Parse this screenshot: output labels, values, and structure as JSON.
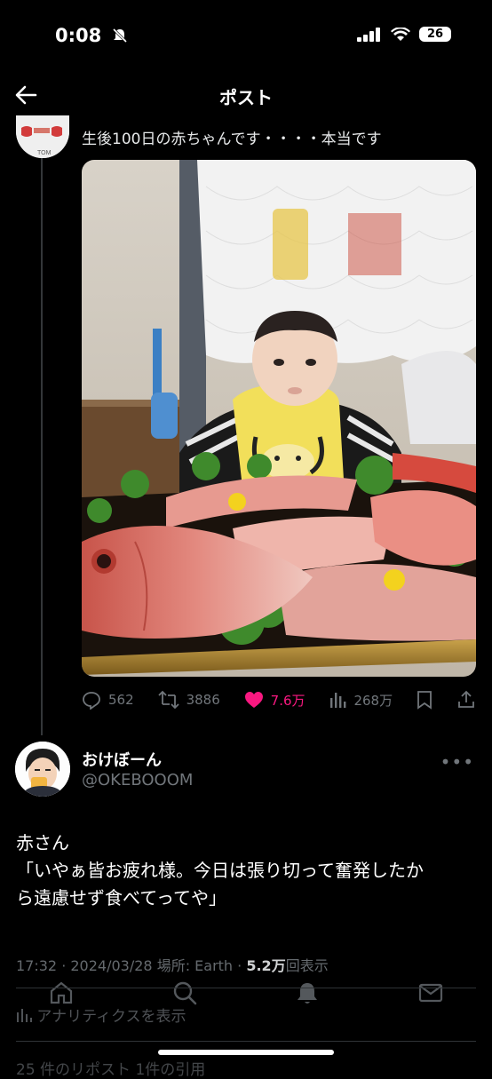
{
  "status_bar": {
    "time": "0:08",
    "battery": "26"
  },
  "header": {
    "title": "ポスト"
  },
  "parent": {
    "avatar_label": "TOM",
    "text": "生後100日の赤ちゃんです・・・・本当です"
  },
  "actions": {
    "replies": "562",
    "reposts": "3886",
    "likes": "7.6万",
    "views": "268万"
  },
  "author": {
    "name": "おけぼーん",
    "handle": "@OKEBOOOM"
  },
  "post": {
    "line1": "赤さん",
    "line2": "「いやぁ皆お疲れ様。今日は張り切って奮発したか",
    "line3": "ら遠慮せず食べてってや」"
  },
  "meta": {
    "time": "17:32",
    "date": "2024/03/28",
    "location": "場所: Earth",
    "views_count": "5.2万",
    "views_label": "回表示"
  },
  "analytics_label": "アナリティクスを表示",
  "repost_row": "25 件のリポスト 1件の引用",
  "colors": {
    "like": "#f91880",
    "muted": "#71767b",
    "background": "#000000"
  },
  "icons": [
    "back-arrow-icon",
    "mute-bell-icon",
    "signal-icon",
    "wifi-icon",
    "reply-icon",
    "repost-icon",
    "heart-icon",
    "views-icon",
    "bookmark-icon",
    "share-icon",
    "more-icon",
    "home-icon",
    "search-icon",
    "notifications-icon",
    "messages-icon",
    "analytics-icon"
  ]
}
